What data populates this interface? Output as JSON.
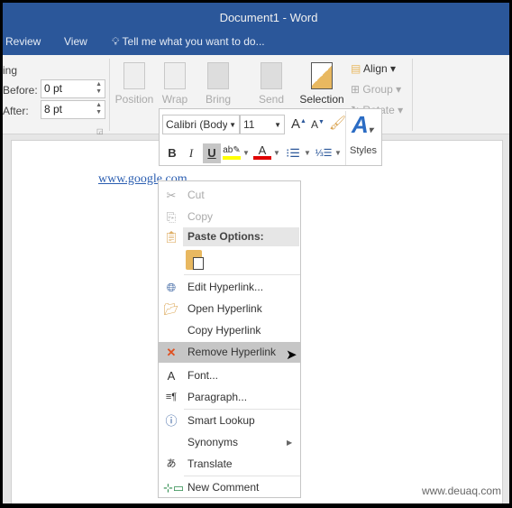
{
  "window": {
    "title": "Document1 - Word"
  },
  "tabs": [
    {
      "label": "Review"
    },
    {
      "label": "View"
    }
  ],
  "tell_me": {
    "placeholder": "Tell me what you want to do..."
  },
  "ribbon": {
    "spacing_label": "ing",
    "before_label": "Before:",
    "before_value": "0 pt",
    "after_label": "After:",
    "after_value": "8 pt",
    "buttons": [
      {
        "label": "Position"
      },
      {
        "label": "Wrap"
      },
      {
        "label": "Bring"
      },
      {
        "label": "Send"
      },
      {
        "label": "Selection"
      }
    ],
    "arrange": [
      {
        "label": "Align"
      },
      {
        "label": "Group"
      },
      {
        "label": "Rotate"
      }
    ]
  },
  "mini_toolbar": {
    "font": "Calibri (Body)",
    "size": "11",
    "bold": "B",
    "italic": "I",
    "underline": "U",
    "styles": "Styles",
    "highlight_color": "#ffff00",
    "font_color": "#e00000"
  },
  "document": {
    "text": "www.google.com"
  },
  "context_menu": {
    "items": [
      {
        "label": "Cut",
        "icon": "scissors-icon",
        "disabled": true
      },
      {
        "label": "Copy",
        "icon": "copy-icon",
        "disabled": true
      },
      {
        "label": "Paste Options:",
        "icon": "paste-icon"
      },
      {
        "label": "Edit Hyperlink...",
        "icon": "edit-hyperlink-icon"
      },
      {
        "label": "Open Hyperlink",
        "icon": "open-hyperlink-icon"
      },
      {
        "label": "Copy Hyperlink"
      },
      {
        "label": "Remove Hyperlink",
        "icon": "remove-hyperlink-icon",
        "highlighted": true
      },
      {
        "label": "Font...",
        "icon": "font-icon"
      },
      {
        "label": "Paragraph...",
        "icon": "paragraph-icon"
      },
      {
        "label": "Smart Lookup",
        "icon": "smart-lookup-icon"
      },
      {
        "label": "Synonyms",
        "icon": "submenu-arrow-icon"
      },
      {
        "label": "Translate",
        "icon": "translate-icon"
      },
      {
        "label": "New Comment",
        "icon": "new-comment-icon"
      }
    ]
  },
  "watermark": "www.deuaq.com"
}
